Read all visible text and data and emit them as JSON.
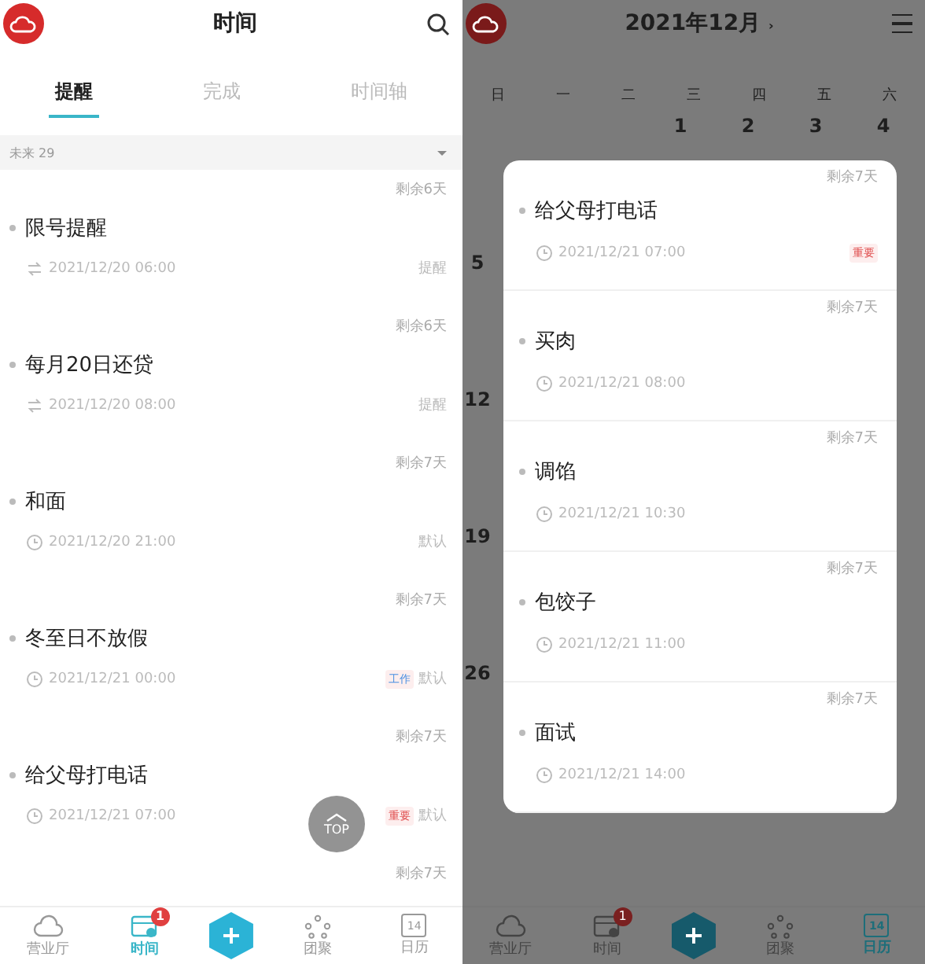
{
  "left": {
    "header": {
      "title": "时间"
    },
    "tabs": [
      {
        "label": "提醒",
        "selected": true
      },
      {
        "label": "完成",
        "selected": false
      },
      {
        "label": "时间轴",
        "selected": false
      }
    ],
    "filter": {
      "label": "未来",
      "count": "29"
    },
    "reminders": [
      {
        "remaining": "剩余6天",
        "title": "限号提醒",
        "kind": "repeating",
        "time": "2021/12/20 06:00",
        "category": "提醒"
      },
      {
        "remaining": "剩余6天",
        "title": "每月20日还贷",
        "kind": "repeating",
        "time": "2021/12/20 08:00",
        "category": "提醒"
      },
      {
        "remaining": "剩余7天",
        "title": "和面",
        "kind": "once",
        "time": "2021/12/20 21:00",
        "category": "默认"
      },
      {
        "remaining": "剩余7天",
        "title": "冬至日不放假",
        "kind": "once",
        "time": "2021/12/21 00:00",
        "tag": {
          "text": "工作",
          "color": "#4a90e2"
        },
        "category": "默认"
      },
      {
        "remaining": "剩余7天",
        "title": "给父母打电话",
        "kind": "once",
        "time": "2021/12/21 07:00",
        "tag": {
          "text": "重要",
          "color": "#e05050"
        },
        "category": "默认"
      },
      {
        "remaining": "剩余7天"
      }
    ],
    "top_button": {
      "label": "TOP"
    },
    "nav": [
      {
        "kind": "cloud",
        "label": "营业厅",
        "selected": false
      },
      {
        "kind": "timeline",
        "label": "时间",
        "selected": true,
        "badge": "1"
      },
      {
        "kind": "add"
      },
      {
        "kind": "group",
        "label": "团聚",
        "selected": false
      },
      {
        "kind": "calendar",
        "label": "日历",
        "icon_text": "14",
        "selected": false
      }
    ]
  },
  "right": {
    "header": {
      "title": "2021年12月",
      "caret": "›"
    },
    "weekdays": [
      "日",
      "一",
      "二",
      "三",
      "四",
      "五",
      "六"
    ],
    "weeks": [
      {
        "kind": "first",
        "days": [
          "1",
          "2",
          "3",
          "4"
        ]
      },
      {
        "kind": "regular",
        "days": [
          "5"
        ]
      },
      {
        "kind": "regular",
        "days": [
          "12"
        ]
      },
      {
        "kind": "regular",
        "days": [
          "19"
        ]
      },
      {
        "kind": "regular",
        "days": [
          "26"
        ]
      }
    ],
    "popup": [
      {
        "remaining": "剩余7天",
        "title": "给父母打电话",
        "time": "2021/12/21 07:00",
        "tag": {
          "text": "重要",
          "color": "#e05050"
        }
      },
      {
        "remaining": "剩余7天",
        "title": "买肉",
        "time": "2021/12/21 08:00"
      },
      {
        "remaining": "剩余7天",
        "title": "调馅",
        "time": "2021/12/21 10:30"
      },
      {
        "remaining": "剩余7天",
        "title": "包饺子",
        "time": "2021/12/21 11:00"
      },
      {
        "remaining": "剩余7天",
        "title": "面试",
        "time": "2021/12/21 14:00"
      }
    ],
    "nav": [
      {
        "kind": "cloud",
        "label": "营业厅",
        "selected": false
      },
      {
        "kind": "timeline",
        "label": "时间",
        "selected": false,
        "badge": "1"
      },
      {
        "kind": "add"
      },
      {
        "kind": "group",
        "label": "团聚",
        "selected": false
      },
      {
        "kind": "calendar",
        "label": "日历",
        "icon_text": "14",
        "selected": true
      }
    ]
  }
}
